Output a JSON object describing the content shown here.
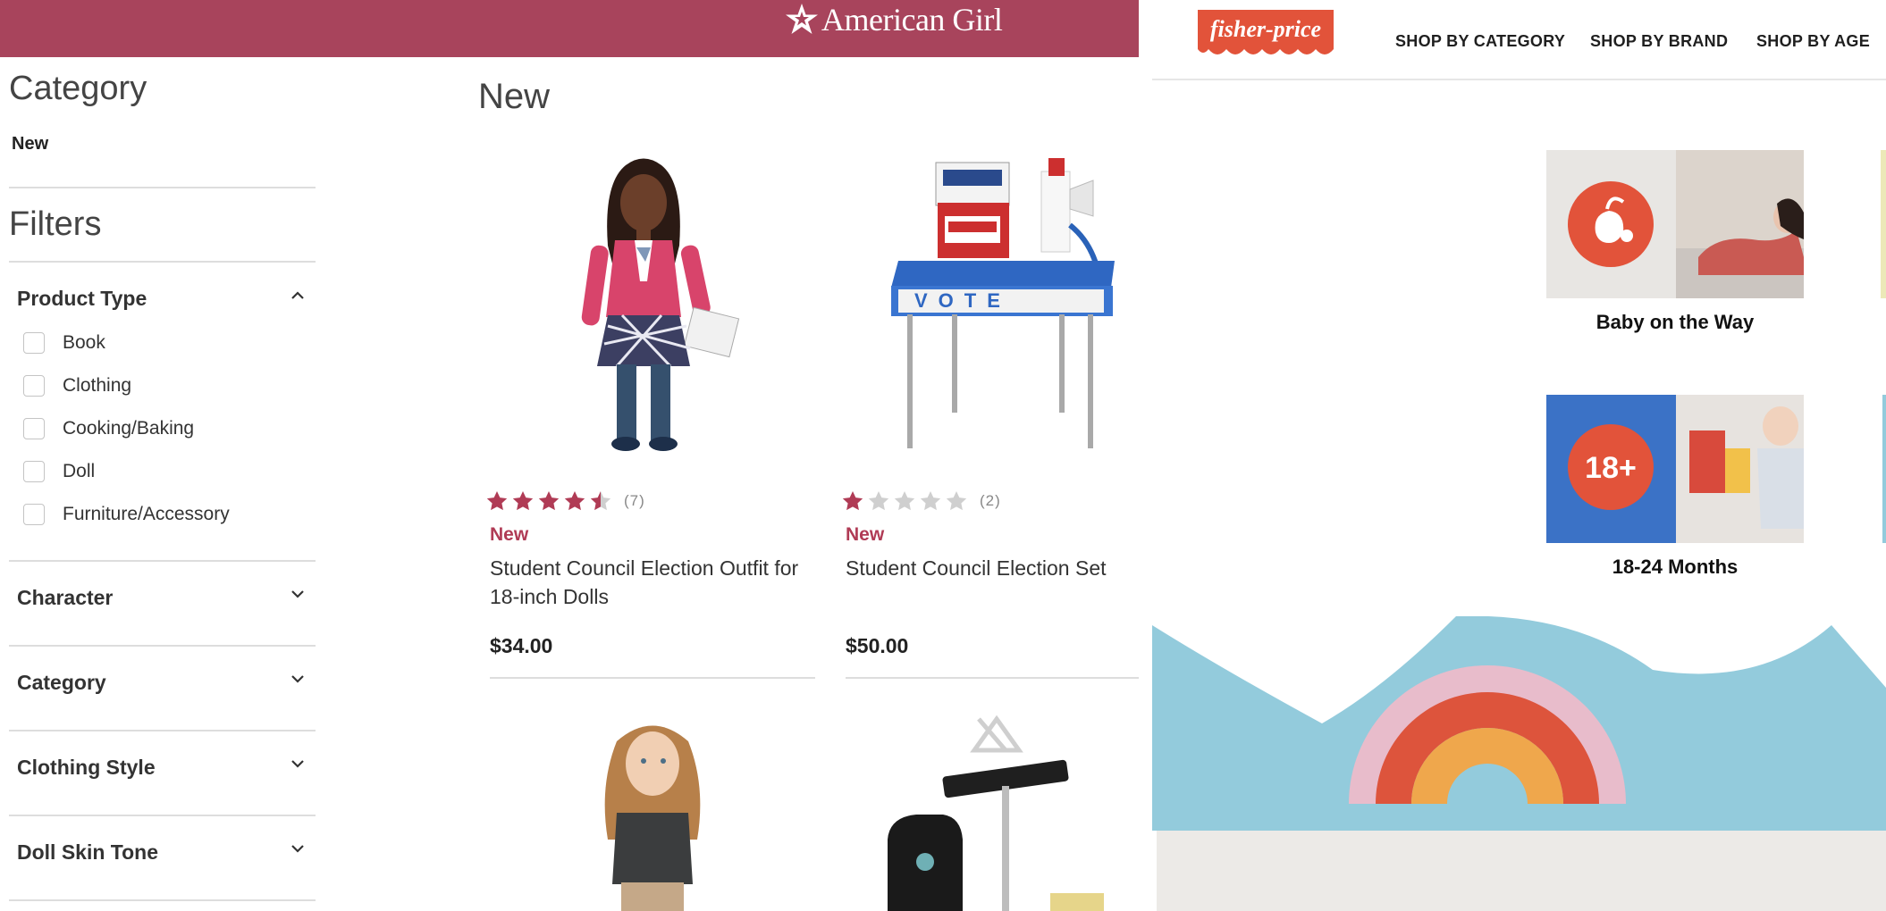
{
  "american_girl": {
    "brand": "American Girl",
    "header_color": "#a8445c",
    "sidebar": {
      "category_title": "Category",
      "category_item": "New",
      "filters_title": "Filters",
      "product_type": {
        "label": "Product Type",
        "expanded": true,
        "options": [
          "Book",
          "Clothing",
          "Cooking/Baking",
          "Doll",
          "Furniture/Accessory"
        ]
      },
      "collapsed_facets": [
        "Character",
        "Category",
        "Clothing Style",
        "Doll Skin Tone"
      ]
    },
    "main": {
      "title": "New",
      "products": [
        {
          "badge": "New",
          "name": "Student Council Election Outfit for 18-inch Dolls",
          "rating": 4.5,
          "reviews_label": "(7)",
          "price": "$34.00"
        },
        {
          "badge": "New",
          "name": "Student Council Election Set",
          "rating": 1,
          "reviews_label": "(2)",
          "price": "$50.00"
        }
      ]
    }
  },
  "fisher_price": {
    "logo_text": "fisher-price",
    "logo_color": "#e2533a",
    "nav": [
      "SHOP BY CATEGORY",
      "SHOP BY BRAND",
      "SHOP BY AGE"
    ],
    "tiles": [
      {
        "label": "Baby on the Way",
        "icon": "bird-egg-icon"
      },
      {
        "label": "18-24 Months",
        "badge_text": "18+"
      }
    ],
    "colors": {
      "sky": "#93cbdc",
      "pink": "#e8bccb",
      "orange_red": "#dd543c",
      "amber": "#efa74c",
      "floor": "#eceae7"
    }
  }
}
